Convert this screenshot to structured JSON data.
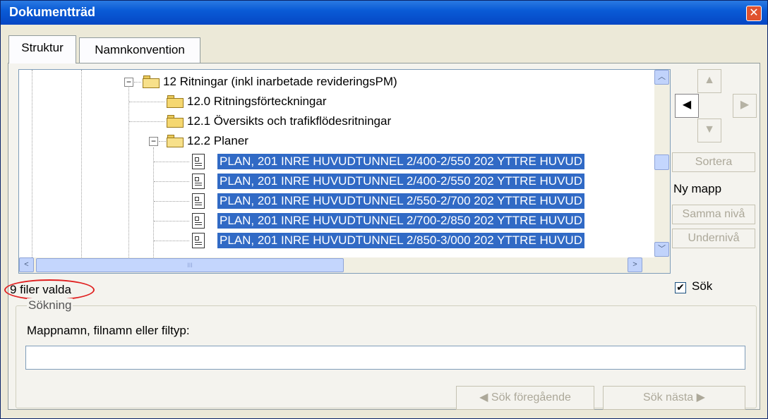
{
  "window": {
    "title": "Dokumentträd",
    "close_glyph": "✕"
  },
  "tabs": [
    {
      "label": "Struktur"
    },
    {
      "label": "Namnkonvention"
    }
  ],
  "tree": {
    "rows": [
      {
        "label": "12 Ritningar (inkl inarbetade revideringsPM)",
        "icon": "folder-open-icon",
        "expander": "−"
      },
      {
        "label": "12.0 Ritningsförteckningar",
        "icon": "folder-icon"
      },
      {
        "label": "12.1 Översikts och trafikflödesritningar",
        "icon": "folder-icon"
      },
      {
        "label": "12.2 Planer",
        "icon": "folder-open-icon",
        "expander": "−"
      },
      {
        "label": "PLAN, 201 INRE HUVUDTUNNEL 2/400-2/550 202 YTTRE HUVUD",
        "icon": "document-icon",
        "selected": true
      },
      {
        "label": "PLAN, 201 INRE HUVUDTUNNEL 2/400-2/550 202 YTTRE HUVUD",
        "icon": "document-icon",
        "selected": true
      },
      {
        "label": "PLAN, 201 INRE HUVUDTUNNEL 2/550-2/700 202 YTTRE HUVUD",
        "icon": "document-icon",
        "selected": true
      },
      {
        "label": "PLAN, 201 INRE HUVUDTUNNEL 2/700-2/850 202 YTTRE HUVUD",
        "icon": "document-icon",
        "selected": true
      },
      {
        "label": "PLAN, 201 INRE HUVUDTUNNEL 2/850-3/000 202 YTTRE HUVUD",
        "icon": "document-icon",
        "selected": true
      }
    ],
    "hscroll_grip": "III"
  },
  "side": {
    "up": "▲",
    "left": "◀",
    "right": "▶",
    "down": "▼",
    "sort_label": "Sortera",
    "new_folder_label": "Ny mapp",
    "same_level_label": "Samma nivå",
    "sub_level_label": "Undernivå",
    "search_checkbox_label": "Sök",
    "search_checked": true,
    "check_glyph": "✔"
  },
  "status": {
    "selected_count_text": "9 filer valda"
  },
  "search": {
    "group_label": "Sökning",
    "field_label": "Mappnamn, filnamn eller filtyp:",
    "field_value": "",
    "prev_label": "Sök föregående",
    "next_label": "Sök nästa",
    "prev_arrow": "◀",
    "next_arrow": "▶"
  },
  "colors": {
    "selection": "#316ac5",
    "titlebar": "#0a5bd6",
    "annotation": "#e02020"
  }
}
